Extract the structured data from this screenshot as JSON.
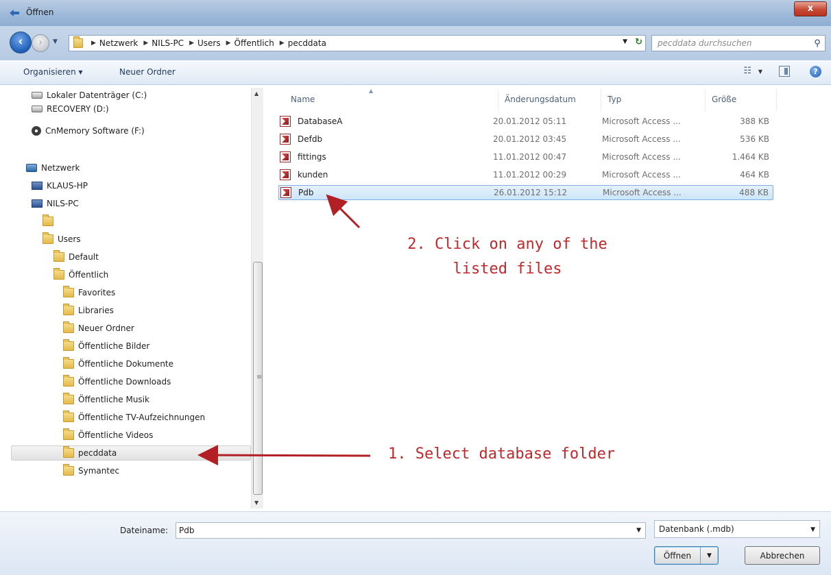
{
  "window": {
    "title": "Öffnen",
    "close_label": "x"
  },
  "address": {
    "crumbs": [
      "Netzwerk",
      "NILS-PC",
      "Users",
      "Öffentlich",
      "pecddata"
    ],
    "search_placeholder": "pecddata durchsuchen"
  },
  "toolbar": {
    "organize_label": "Organisieren ▾",
    "new_folder_label": "Neuer Ordner"
  },
  "nav": {
    "items": [
      {
        "label": "Lokaler Datenträger (C:)",
        "icon": "hard-drive-icon"
      },
      {
        "label": "RECOVERY (D:)",
        "icon": "drive-icon"
      },
      {
        "label": "CnMemory Software (F:)",
        "icon": "disc-icon"
      },
      {
        "label": "Netzwerk",
        "icon": "network-icon"
      },
      {
        "label": "KLAUS-HP",
        "icon": "computer-icon"
      },
      {
        "label": "NILS-PC",
        "icon": "computer-icon"
      },
      {
        "label": "",
        "icon": "folder-icon"
      },
      {
        "label": "Users",
        "icon": "folder-icon"
      },
      {
        "label": "Default",
        "icon": "folder-icon"
      },
      {
        "label": "Öffentlich",
        "icon": "folder-icon"
      },
      {
        "label": "Favorites",
        "icon": "folder-icon"
      },
      {
        "label": "Libraries",
        "icon": "folder-icon"
      },
      {
        "label": "Neuer Ordner",
        "icon": "folder-icon"
      },
      {
        "label": "Öffentliche Bilder",
        "icon": "folder-icon"
      },
      {
        "label": "Öffentliche Dokumente",
        "icon": "folder-icon"
      },
      {
        "label": "Öffentliche Downloads",
        "icon": "folder-icon"
      },
      {
        "label": "Öffentliche Musik",
        "icon": "folder-icon"
      },
      {
        "label": "Öffentliche TV-Aufzeichnungen",
        "icon": "folder-icon"
      },
      {
        "label": "Öffentliche Videos",
        "icon": "folder-icon"
      },
      {
        "label": "pecddata",
        "icon": "folder-icon",
        "selected": true
      },
      {
        "label": "Symantec",
        "icon": "folder-icon"
      }
    ]
  },
  "files": {
    "columns": {
      "name": "Name",
      "date": "Änderungsdatum",
      "type": "Typ",
      "size": "Größe"
    },
    "rows": [
      {
        "name": "DatabaseA",
        "date": "20.01.2012 05:11",
        "type": "Microsoft Access ...",
        "size": "388 KB"
      },
      {
        "name": "Defdb",
        "date": "20.01.2012 03:45",
        "type": "Microsoft Access ...",
        "size": "536 KB"
      },
      {
        "name": "fittings",
        "date": "11.01.2012 00:47",
        "type": "Microsoft Access ...",
        "size": "1.464 KB"
      },
      {
        "name": "kunden",
        "date": "11.01.2012 00:29",
        "type": "Microsoft Access ...",
        "size": "464 KB"
      },
      {
        "name": "Pdb",
        "date": "26.01.2012 15:12",
        "type": "Microsoft Access ...",
        "size": "488 KB",
        "selected": true
      }
    ]
  },
  "annotations": {
    "step2_line1": "2. Click on any of the",
    "step2_line2": "listed files",
    "step1": "1. Select database folder",
    "color": "#c0282b"
  },
  "footer": {
    "filename_label": "Dateiname:",
    "filename_value": "Pdb",
    "filetype_value": "Datenbank (.mdb)",
    "open_label": "Öffnen",
    "cancel_label": "Abbrechen"
  }
}
